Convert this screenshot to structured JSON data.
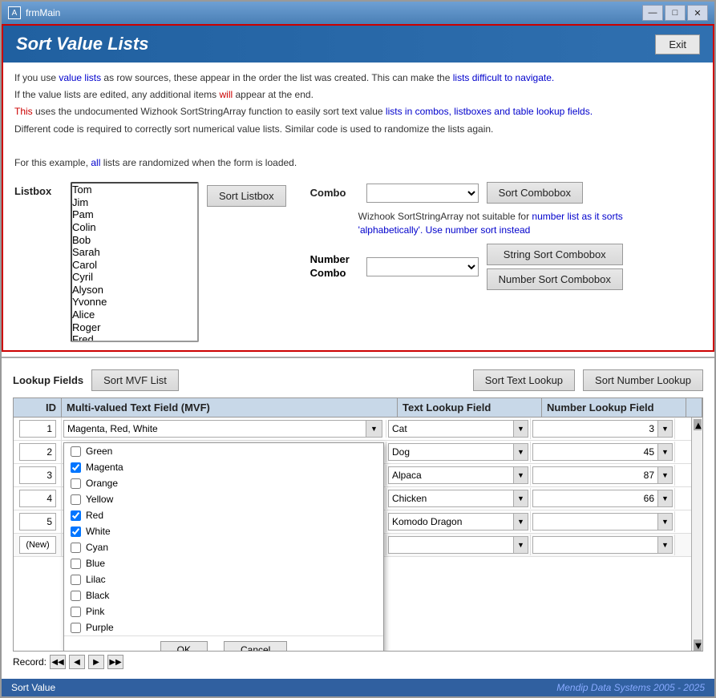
{
  "window": {
    "title": "frmMain",
    "icon": "app-icon"
  },
  "header": {
    "title": "Sort Value Lists",
    "exit_label": "Exit"
  },
  "description": {
    "line1": "If you use value lists as row sources, these appear in the order the list was created. This can make the lists difficult to navigate.",
    "line2": "If the value lists are edited, any additional items will appear at the end.",
    "line3_prefix": "This uses the undocumented Wizhook SortStringArray function to easily sort text value ",
    "line3_mid": "lists in combos, listboxes and table lookup fields.",
    "line4": "Different code is required to correctly sort numerical value lists. Similar code is used to randomize the lists again.",
    "line5": "",
    "line6": "For this example, all lists are randomized when the form is loaded."
  },
  "listbox": {
    "label": "Listbox",
    "items": [
      "Tom",
      "Jim",
      "Pam",
      "Colin",
      "Bob",
      "Sarah",
      "Carol",
      "Cyril",
      "Alyson",
      "Yvonne",
      "Alice",
      "Roger",
      "Fred"
    ],
    "sort_button": "Sort Listbox"
  },
  "combo": {
    "label": "Combo",
    "sort_button": "Sort Combobox",
    "value": ""
  },
  "notice": {
    "text": "Wizhook SortStringArray not suitable for number list as it sorts 'alphabetically'. Use number sort instead"
  },
  "number_combo": {
    "label_line1": "Number",
    "label_line2": "Combo",
    "string_sort_btn": "String Sort Combobox",
    "number_sort_btn": "Number Sort Combobox",
    "value": ""
  },
  "lookup": {
    "label": "Lookup Fields",
    "sort_mvf_btn": "Sort MVF List",
    "sort_text_btn": "Sort Text Lookup",
    "sort_number_btn": "Sort Number Lookup",
    "columns": {
      "id": "ID",
      "mvf": "Multi-valued Text Field (MVF)",
      "text": "Text Lookup Field",
      "number": "Number Lookup Field"
    },
    "rows": [
      {
        "id": "1",
        "mvf": "Magenta, Red, White",
        "text_val": "Cat",
        "number_val": "3"
      },
      {
        "id": "2",
        "mvf": "",
        "text_val": "Dog",
        "number_val": "45"
      },
      {
        "id": "3",
        "mvf": "",
        "text_val": "Alpaca",
        "number_val": "87"
      },
      {
        "id": "4",
        "mvf": "",
        "text_val": "Chicken",
        "number_val": "66"
      },
      {
        "id": "5",
        "mvf": "",
        "text_val": "Komodo Dragon",
        "number_val": ""
      },
      {
        "id": "",
        "mvf": "",
        "text_val": "",
        "number_val": ""
      }
    ],
    "new_row_label": "(New)"
  },
  "dropdown": {
    "items": [
      {
        "label": "Green",
        "checked": false
      },
      {
        "label": "Magenta",
        "checked": true
      },
      {
        "label": "Orange",
        "checked": false
      },
      {
        "label": "Yellow",
        "checked": false
      },
      {
        "label": "Red",
        "checked": true
      },
      {
        "label": "White",
        "checked": true
      },
      {
        "label": "Cyan",
        "checked": false
      },
      {
        "label": "Blue",
        "checked": false
      },
      {
        "label": "Lilac",
        "checked": false
      },
      {
        "label": "Black",
        "checked": false
      },
      {
        "label": "Pink",
        "checked": false
      },
      {
        "label": "Purple",
        "checked": false
      }
    ],
    "ok_label": "OK",
    "cancel_label": "Cancel"
  },
  "record_nav": {
    "label": "Record:",
    "first_btn": "◀◀",
    "prev_btn": "◀",
    "next_btn": "▶",
    "last_btn": "▶▶"
  },
  "status": {
    "left": "Sort Value",
    "right": "Mendip Data Systems 2005 - 2025"
  },
  "titlebar_controls": {
    "minimize": "—",
    "maximize": "□",
    "close": "✕"
  }
}
